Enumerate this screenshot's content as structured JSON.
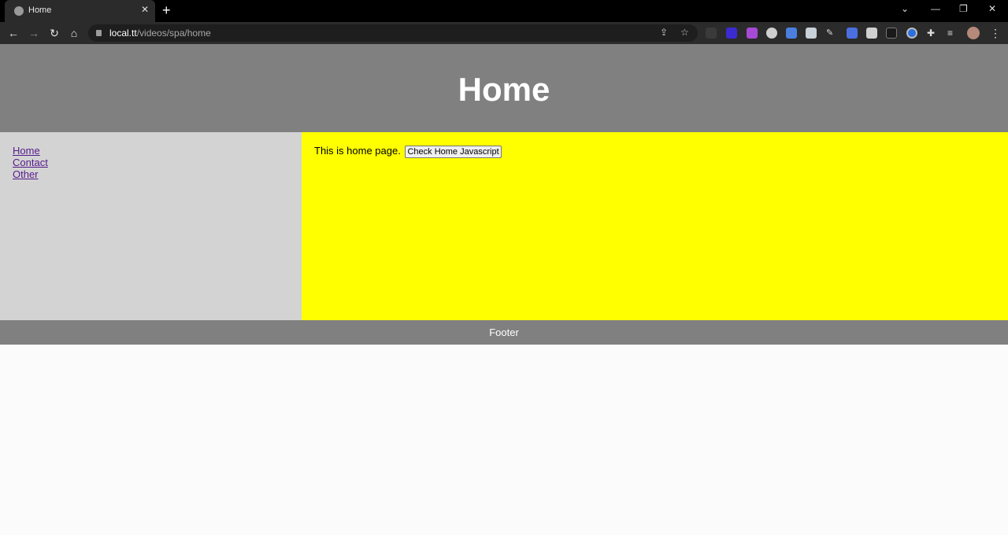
{
  "browser": {
    "tab_title": "Home",
    "new_tab": "+",
    "url_host": "local.tt",
    "url_path": "/videos/spa/home"
  },
  "page": {
    "header_title": "Home",
    "sidebar": {
      "links": [
        "Home",
        "Contact",
        "Other"
      ]
    },
    "content": {
      "text": "This is home page.",
      "button_label": "Check Home Javascript"
    },
    "footer": "Footer"
  },
  "colors": {
    "header_bg": "#808080",
    "sidebar_bg": "#d3d3d3",
    "content_bg": "#ffff00",
    "link": "#551a8b"
  }
}
